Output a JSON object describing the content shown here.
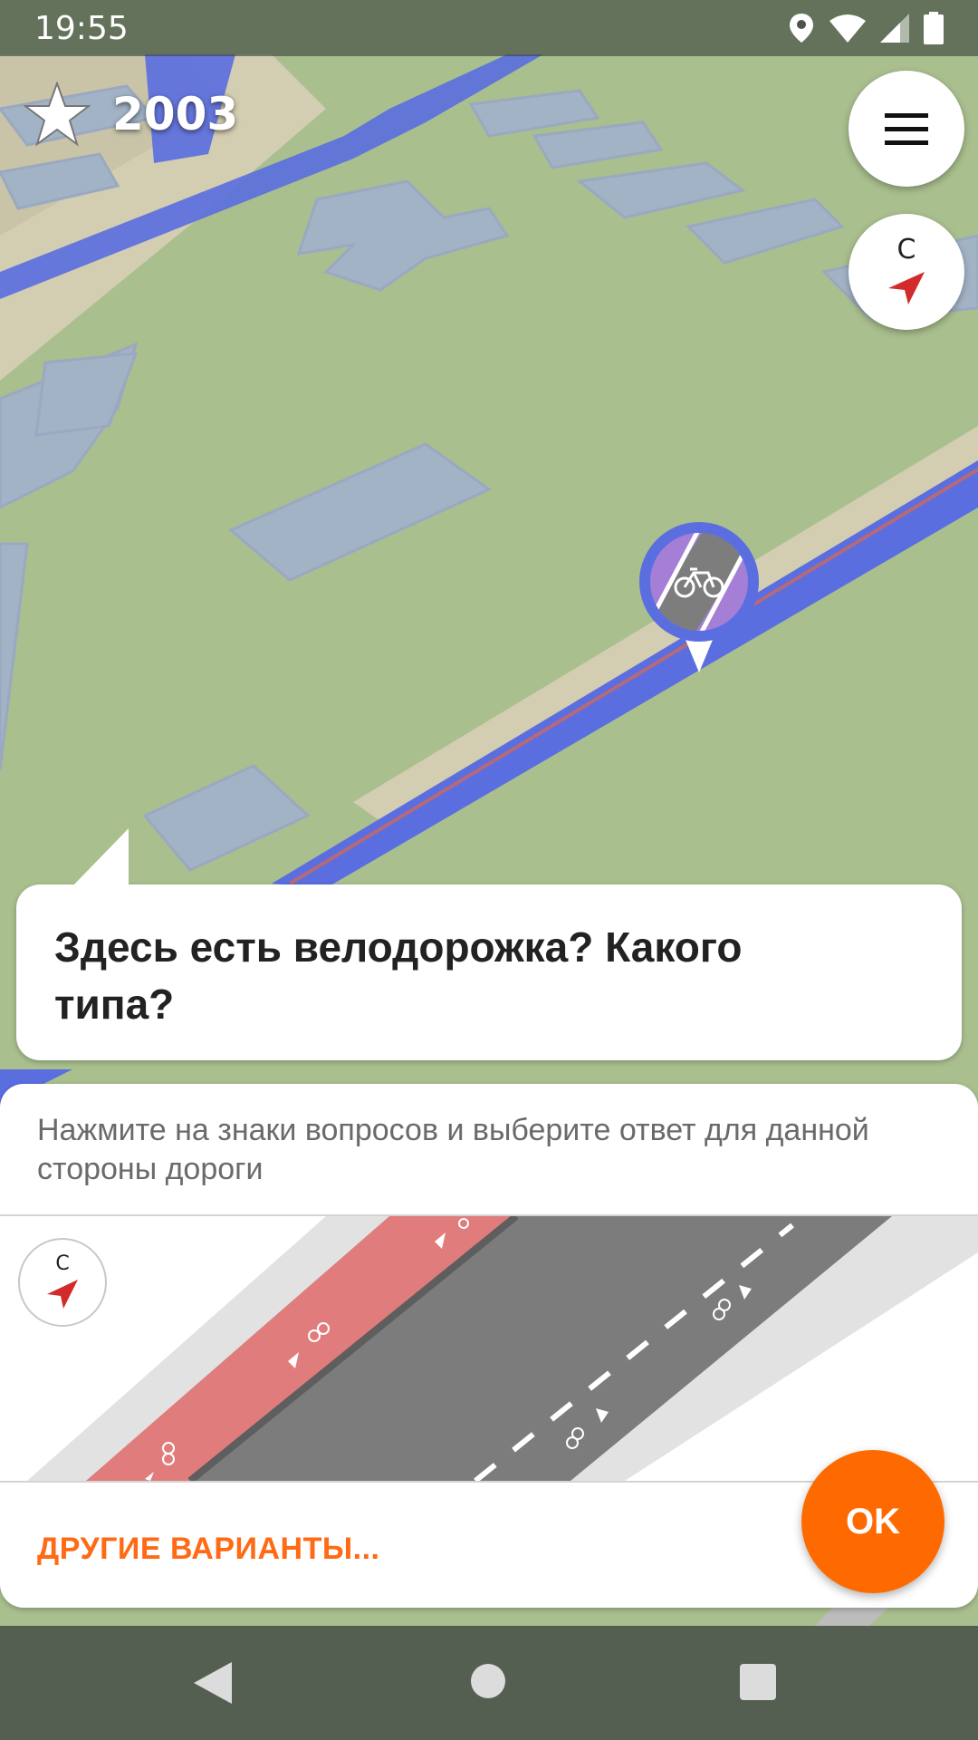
{
  "status_bar": {
    "time": "19:55",
    "icons": [
      "location-icon",
      "wifi-icon",
      "signal-icon",
      "battery-icon"
    ]
  },
  "header": {
    "star_icon": "star-icon",
    "star_count": "2003",
    "menu_icon": "menu-icon",
    "compass_letter": "С"
  },
  "quest": {
    "marker_icon": "bicycle-lane-icon",
    "question": "Здесь есть велодорожка? Какого типа?",
    "hint": "Нажмите на знаки вопросов и выберите ответ для данной стороны дороги",
    "mini_compass_letter": "С",
    "other_answers": "ДРУГИЕ ВАРИАНТЫ...",
    "ok": "OK"
  },
  "nav_bar": {
    "icons": [
      "back-icon",
      "home-icon",
      "recents-icon"
    ]
  },
  "colors": {
    "accent": "#ff6a00",
    "road_blue": "#5a6ee0",
    "map_green": "#a9bf8e",
    "building": "#a3b3c6",
    "bike_lane_red": "#e07c7c"
  }
}
